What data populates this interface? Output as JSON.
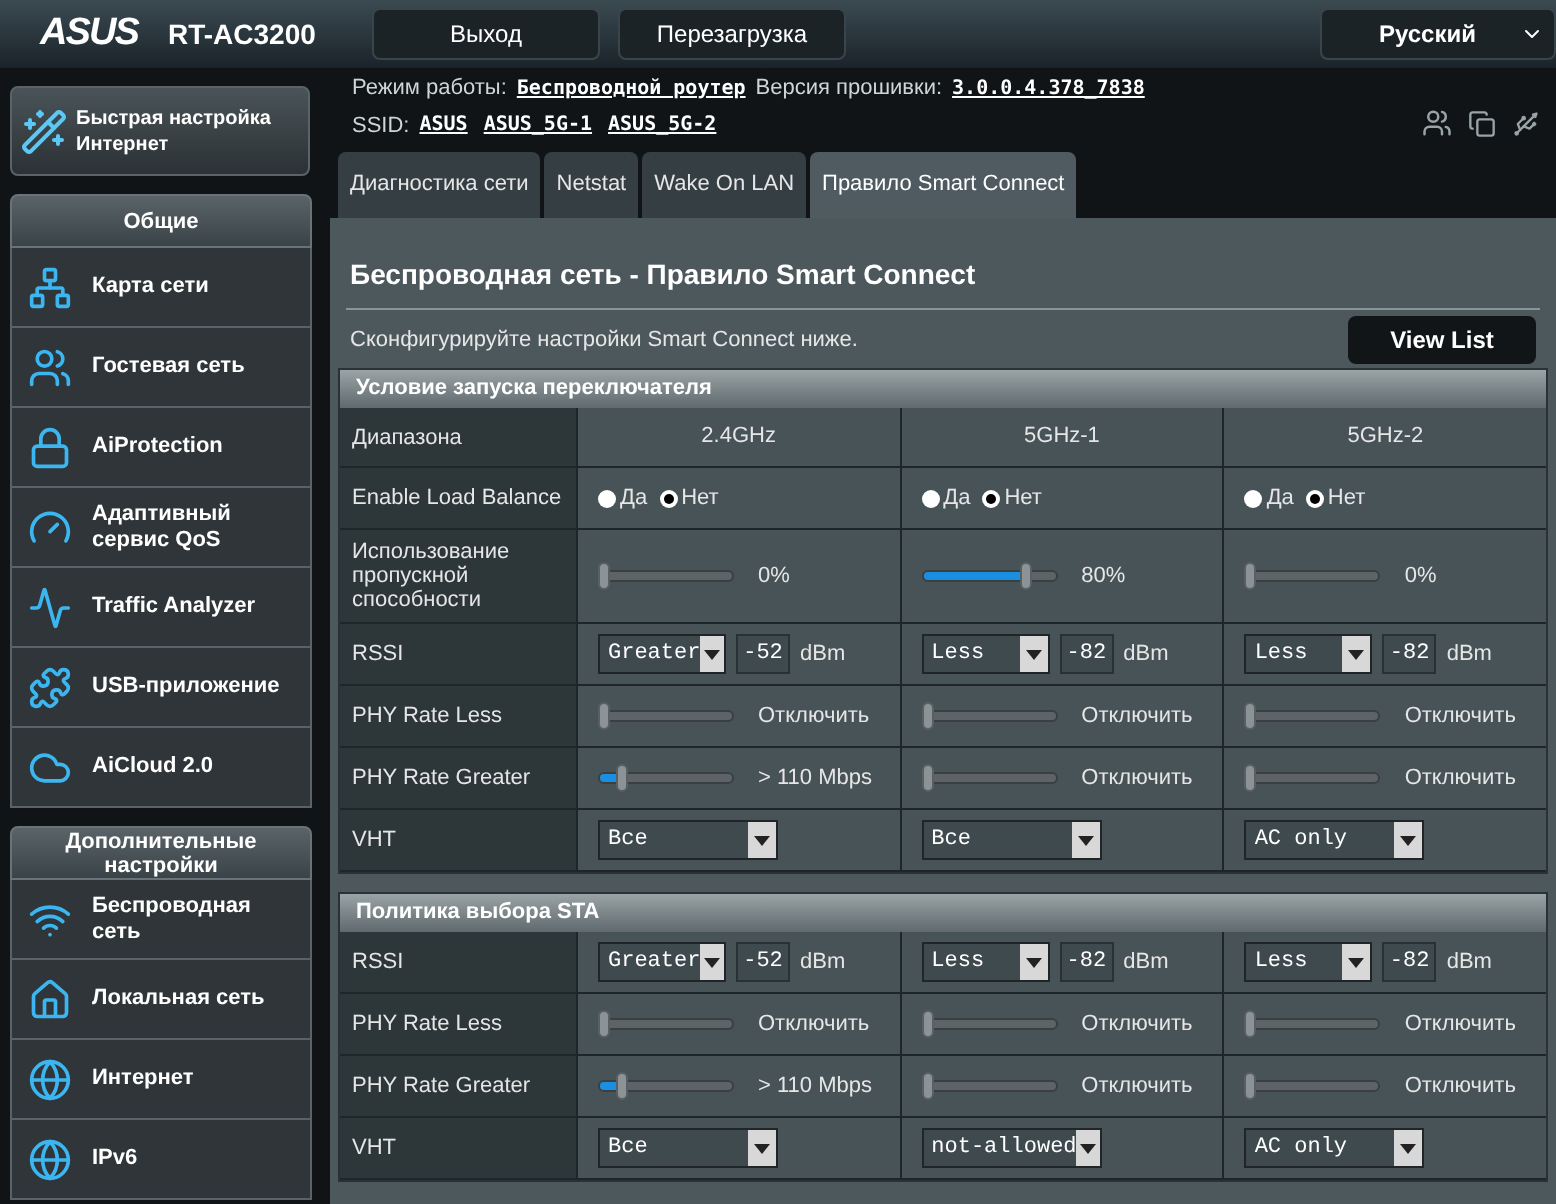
{
  "header": {
    "logo": "ASUS",
    "model": "RT-AC3200",
    "buttons": [
      "Выход",
      "Перезагрузка"
    ],
    "language": "Русский"
  },
  "info": {
    "mode_label": "Режим работы:",
    "mode": "Беспроводной роутер",
    "fw_label": "Версия прошивки:",
    "fw": "3.0.0.4.378_7838",
    "ssid_label": "SSID:",
    "ssids": [
      "ASUS",
      "ASUS_5G-1",
      "ASUS_5G-2"
    ]
  },
  "quick_setup": "Быстрая настройка Интернет",
  "sidebar": [
    {
      "title": "Общие",
      "items": [
        {
          "label": "Карта сети",
          "selected": false
        },
        {
          "label": "Гостевая сеть",
          "selected": false
        },
        {
          "label": "AiProtection",
          "selected": false
        },
        {
          "label": "Адаптивный сервис QoS",
          "selected": false
        },
        {
          "label": "Traffic Analyzer",
          "selected": false
        },
        {
          "label": "USB-приложение",
          "selected": false
        },
        {
          "label": "AiCloud 2.0",
          "selected": false
        }
      ]
    },
    {
      "title": "Дополнительные настройки",
      "items": [
        {
          "label": "Беспроводная сеть",
          "selected": false
        },
        {
          "label": "Локальная сеть",
          "selected": false
        },
        {
          "label": "Интернет",
          "selected": false
        },
        {
          "label": "IPv6",
          "selected": false
        }
      ]
    }
  ],
  "tabs": [
    {
      "label": "Диагностика сети",
      "selected": false
    },
    {
      "label": "Netstat",
      "selected": false
    },
    {
      "label": "Wake On LAN",
      "selected": false
    },
    {
      "label": "Правило Smart Connect",
      "selected": true
    }
  ],
  "panel": {
    "title": "Беспроводная сеть - Правило Smart Connect",
    "description": "Сконфигурируйте настройки Smart Connect ниже.",
    "button": "View List"
  },
  "sections": [
    {
      "title": "Условие запуска переключателя",
      "rows": [
        {
          "kind": "text",
          "label": "Диапазона",
          "cells": [
            {
              "text": "2.4GHz"
            },
            {
              "text": "5GHz-1"
            },
            {
              "text": "5GHz-2"
            }
          ]
        },
        {
          "kind": "radio",
          "label": "Enable Load Balance",
          "cells": [
            {
              "options": [
                {
                  "label": "Да",
                  "selected": false
                },
                {
                  "label": "Нет",
                  "selected": true
                }
              ]
            },
            {
              "options": [
                {
                  "label": "Да",
                  "selected": false
                },
                {
                  "label": "Нет",
                  "selected": true
                }
              ]
            },
            {
              "options": [
                {
                  "label": "Да",
                  "selected": false
                },
                {
                  "label": "Нет",
                  "selected": true
                }
              ]
            }
          ]
        },
        {
          "kind": "slider",
          "label": "Использование пропускной способности",
          "cells": [
            {
              "level": 0,
              "reading": "0%"
            },
            {
              "level": 0.8,
              "reading": "80%"
            },
            {
              "level": 0,
              "reading": "0%"
            }
          ]
        },
        {
          "kind": "rssi",
          "label": "RSSI",
          "cells": [
            {
              "value": "Greater",
              "number": "-52",
              "unit": "dBm"
            },
            {
              "value": "Less",
              "number": "-82",
              "unit": "dBm"
            },
            {
              "value": "Less",
              "number": "-82",
              "unit": "dBm"
            }
          ]
        },
        {
          "kind": "slider",
          "label": "PHY Rate Less",
          "cells": [
            {
              "level": 0,
              "reading": "Отключить"
            },
            {
              "level": 0,
              "reading": "Отключить"
            },
            {
              "level": 0,
              "reading": "Отключить"
            }
          ]
        },
        {
          "kind": "slider",
          "label": "PHY Rate Greater",
          "cells": [
            {
              "level": 0.15,
              "reading": "> 110 Mbps"
            },
            {
              "level": 0,
              "reading": "Отключить"
            },
            {
              "level": 0,
              "reading": "Отключить"
            }
          ]
        },
        {
          "kind": "select",
          "label": "VHT",
          "cells": [
            {
              "value": "Все"
            },
            {
              "value": "Все"
            },
            {
              "value": "AC only"
            }
          ]
        }
      ]
    },
    {
      "title": "Политика выбора STA",
      "rows": [
        {
          "kind": "rssi",
          "label": "RSSI",
          "cells": [
            {
              "value": "Greater",
              "number": "-52",
              "unit": "dBm"
            },
            {
              "value": "Less",
              "number": "-82",
              "unit": "dBm"
            },
            {
              "value": "Less",
              "number": "-82",
              "unit": "dBm"
            }
          ]
        },
        {
          "kind": "slider",
          "label": "PHY Rate Less",
          "cells": [
            {
              "level": 0,
              "reading": "Отключить"
            },
            {
              "level": 0,
              "reading": "Отключить"
            },
            {
              "level": 0,
              "reading": "Отключить"
            }
          ]
        },
        {
          "kind": "slider",
          "label": "PHY Rate Greater",
          "cells": [
            {
              "level": 0.15,
              "reading": "> 110 Mbps"
            },
            {
              "level": 0,
              "reading": "Отключить"
            },
            {
              "level": 0,
              "reading": "Отключить"
            }
          ]
        },
        {
          "kind": "select",
          "label": "VHT",
          "cells": [
            {
              "value": "Все"
            },
            {
              "value": "not-allowed"
            },
            {
              "value": "AC only"
            }
          ]
        }
      ]
    }
  ]
}
